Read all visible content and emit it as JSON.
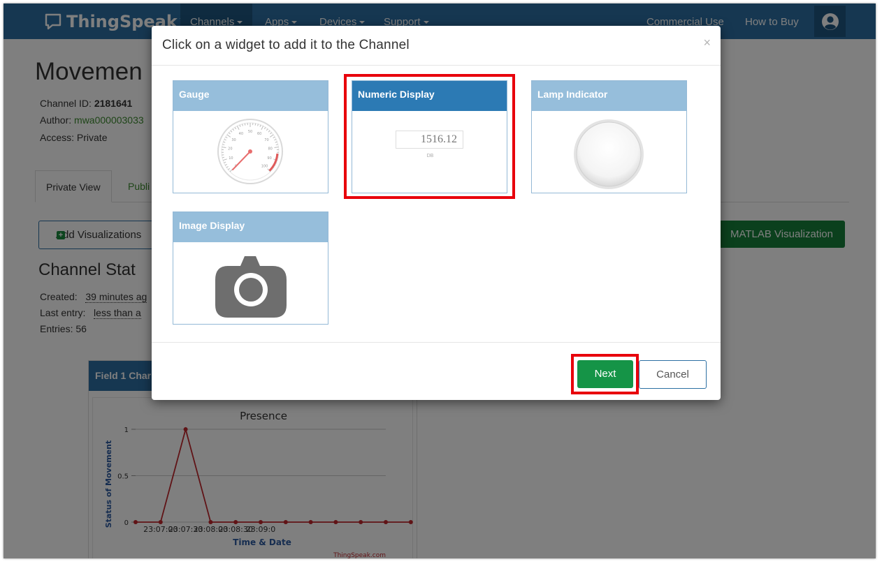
{
  "navbar": {
    "brand": "ThingSpeak",
    "brand_tm": "™",
    "items": [
      {
        "label": "Channels"
      },
      {
        "label": "Apps"
      },
      {
        "label": "Devices"
      },
      {
        "label": "Support"
      }
    ],
    "right_items": [
      {
        "label": "Commercial Use"
      },
      {
        "label": "How to Buy"
      }
    ]
  },
  "channel": {
    "title": "Movemen",
    "id_label": "Channel ID:",
    "id_value": "2181641",
    "author_label": "Author:",
    "author_value": "mwa000003033",
    "access": "Access: Private"
  },
  "tabs": [
    {
      "label": "Private View"
    },
    {
      "label": "Publi"
    }
  ],
  "buttons": {
    "add_visualizations": "Add Visualizations",
    "matlab_visualization": "MATLAB Visualization"
  },
  "status": {
    "title": "Channel Stat",
    "created_label": "Created:",
    "created_value": "39 minutes ag",
    "last_entry_label": "Last entry:",
    "last_entry_value": "less than a",
    "entries": "Entries: 56"
  },
  "field_chart": {
    "panel_title": "Field 1 Char",
    "credit": "ThingSpeak.com",
    "colors": {
      "line": "#c0272d",
      "grid": "#c8c8c8"
    }
  },
  "modal": {
    "title": "Click on a widget to add it to the Channel",
    "close": "×",
    "widgets": [
      {
        "label": "Gauge"
      },
      {
        "label": "Numeric Display",
        "preview_value": "1516.12",
        "preview_unit": "DB"
      },
      {
        "label": "Lamp Indicator"
      },
      {
        "label": "Image Display"
      }
    ],
    "selected_widget": "Numeric Display",
    "next_label": "Next",
    "cancel_label": "Cancel"
  },
  "gauge_ticks": [
    "0",
    "10",
    "20",
    "30",
    "40",
    "50",
    "60",
    "70",
    "80",
    "90",
    "100"
  ],
  "chart_data": {
    "type": "line",
    "title": "Presence",
    "xlabel": "Time & Date",
    "ylabel": "Status of Movement",
    "x_ticks": [
      "23:07:00",
      "23:07:30",
      "23:08:00",
      "23:08:30",
      "23:09:0"
    ],
    "y_ticks": [
      "0",
      "0.5",
      "1"
    ],
    "ylim": [
      0,
      1
    ],
    "x_minutes": [
      -0.5,
      0,
      0.5,
      1,
      1.5,
      2,
      2.5,
      3,
      3.5,
      4,
      4.5,
      5
    ],
    "values": [
      0,
      0,
      1,
      0,
      0,
      0,
      0,
      0,
      0,
      0,
      0,
      0
    ],
    "grid": true,
    "legend": "none"
  }
}
